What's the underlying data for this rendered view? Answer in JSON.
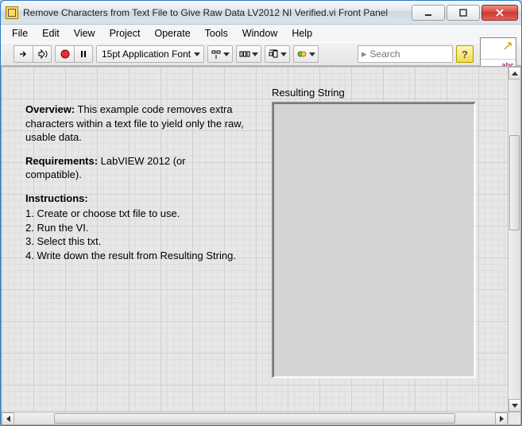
{
  "window_title": "Remove Characters from Text File to Give Raw Data LV2012 NI Verified.vi Front Panel",
  "menu": {
    "file": "File",
    "edit": "Edit",
    "view": "View",
    "project": "Project",
    "operate": "Operate",
    "tools": "Tools",
    "window": "Window",
    "help": "Help"
  },
  "toolbar": {
    "font_label": "15pt Application Font",
    "search_placeholder": "Search",
    "help_glyph": "?"
  },
  "context_help_glyph": "abc",
  "overview": {
    "overview_label": "Overview:",
    "overview_text": " This example code removes extra characters within a text file to yield only the raw, usable data.",
    "req_label": "Requirements:",
    "req_text": " LabVIEW 2012 (or compatible).",
    "instr_label": "Instructions:",
    "step1": "1. Create or choose txt file to use.",
    "step2": "2. Run the VI.",
    "step3": "3. Select this txt.",
    "step4": "4. Write down the result from Resulting String."
  },
  "resulting_string": {
    "label": "Resulting String",
    "value": ""
  }
}
